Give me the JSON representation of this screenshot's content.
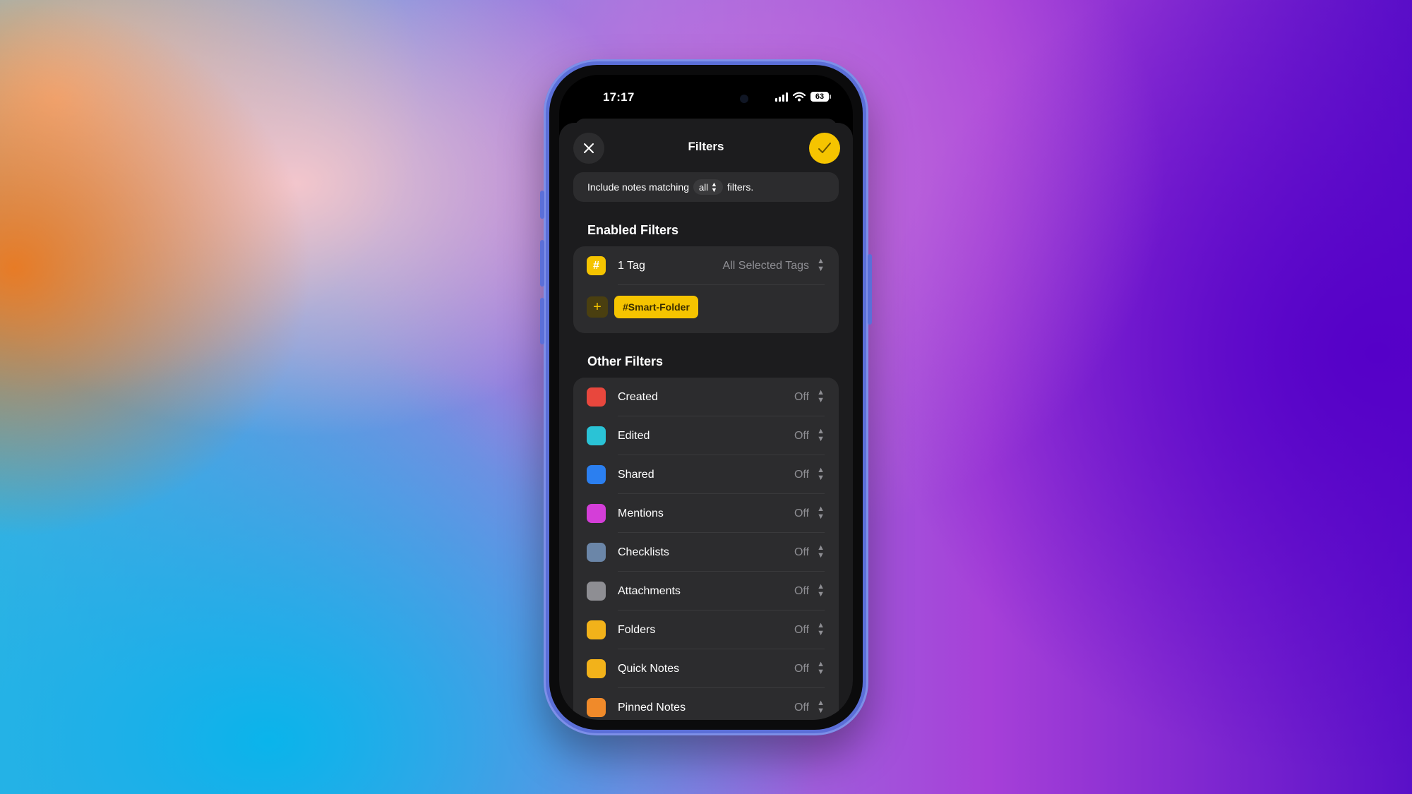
{
  "status_bar": {
    "time": "17:17",
    "battery": "63"
  },
  "header": {
    "title": "Filters",
    "close_icon": "close-icon",
    "done_icon": "checkmark-icon"
  },
  "match_bar": {
    "prefix": "Include notes matching",
    "mode": "all",
    "suffix": "filters."
  },
  "enabled": {
    "heading": "Enabled Filters",
    "tag_filter": {
      "label": "1 Tag",
      "value": "All Selected Tags"
    },
    "tags": [
      "#Smart-Folder"
    ]
  },
  "other": {
    "heading": "Other Filters",
    "items": [
      {
        "label": "Created",
        "value": "Off",
        "icon": "calendar-icon",
        "color": "#e8473d"
      },
      {
        "label": "Edited",
        "value": "Off",
        "icon": "pencil-icon",
        "color": "#2ac3d6"
      },
      {
        "label": "Shared",
        "value": "Off",
        "icon": "shared-person-icon",
        "color": "#2b7ff0"
      },
      {
        "label": "Mentions",
        "value": "Off",
        "icon": "at-sign-icon",
        "color": "#d43ed8"
      },
      {
        "label": "Checklists",
        "value": "Off",
        "icon": "checklist-icon",
        "color": "#6b86a8"
      },
      {
        "label": "Attachments",
        "value": "Off",
        "icon": "paperclip-icon",
        "color": "#8e8e93"
      },
      {
        "label": "Folders",
        "value": "Off",
        "icon": "folder-icon",
        "color": "#f2b21a"
      },
      {
        "label": "Quick Notes",
        "value": "Off",
        "icon": "quick-note-icon",
        "color": "#f2b21a"
      },
      {
        "label": "Pinned Notes",
        "value": "Off",
        "icon": "pin-icon",
        "color": "#f08a2a"
      }
    ]
  },
  "colors": {
    "accent": "#f5c400",
    "sheet": "#1c1c1e",
    "card": "#2c2c2e"
  }
}
